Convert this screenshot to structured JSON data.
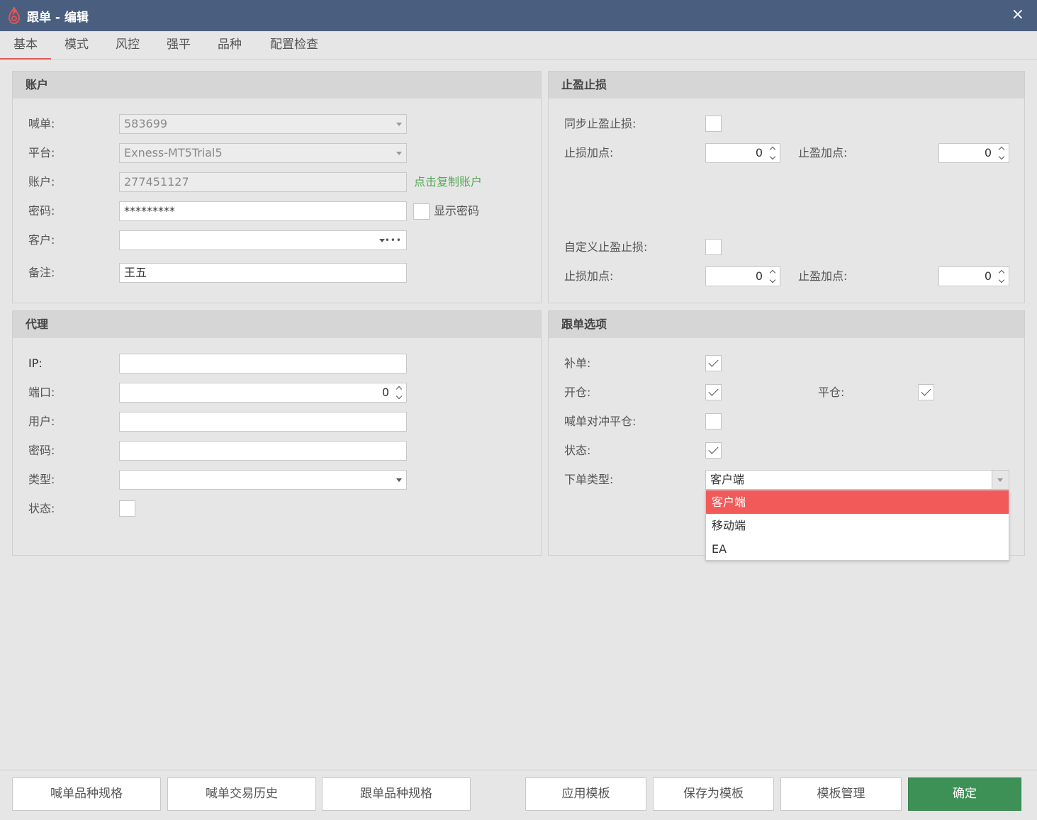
{
  "window": {
    "title": "跟单 - 编辑",
    "close_icon": "×",
    "logo_color": "#e25656",
    "titlebar_color": "#4a5e80"
  },
  "tabs": [
    {
      "label": "基本",
      "active": true
    },
    {
      "label": "模式"
    },
    {
      "label": "风控"
    },
    {
      "label": "强平"
    },
    {
      "label": "品种"
    },
    {
      "label": "配置检查"
    }
  ],
  "account": {
    "header": "账户",
    "caller_label": "喊单:",
    "caller_value": "583699",
    "platform_label": "平台:",
    "platform_value": "Exness-MT5Trial5",
    "account_label": "账户:",
    "account_value": "277451127",
    "copy_link": "点击复制账户",
    "password_label": "密码:",
    "password_value": "*********",
    "show_password": "显示密码",
    "client_label": "客户:",
    "client_value": "",
    "note_label": "备注:",
    "note_value": "王五"
  },
  "tpsl": {
    "header": "止盈止损",
    "sync_label": "同步止盈止损:",
    "sl_label": "止损加点:",
    "sl_value": "0",
    "tp_label": "止盈加点:",
    "tp_value": "0",
    "custom_label": "自定义止盈止损:",
    "sl2_label": "止损加点:",
    "sl2_value": "0",
    "tp2_label": "止盈加点:",
    "tp2_value": "0"
  },
  "proxy": {
    "header": "代理",
    "ip_label": "IP:",
    "ip_value": "",
    "port_label": "端口:",
    "port_value": "0",
    "user_label": "用户:",
    "user_value": "",
    "password_label": "密码:",
    "password_value": "",
    "type_label": "类型:",
    "type_value": "",
    "status_label": "状态:"
  },
  "options": {
    "header": "跟单选项",
    "supplement_label": "补单:",
    "supplement_checked": true,
    "open_label": "开仓:",
    "open_checked": true,
    "close_label": "平仓:",
    "close_checked": true,
    "hedge_label": "喊单对冲平仓:",
    "hedge_checked": false,
    "status_label": "状态:",
    "status_checked": true,
    "order_type_label": "下单类型:",
    "order_type_value": "客户端",
    "order_type_options": [
      "客户端",
      "移动端",
      "EA"
    ],
    "selected_color": "#f25a5a"
  },
  "footer": {
    "caller_spec": "喊单品种规格",
    "caller_history": "喊单交易历史",
    "follower_spec": "跟单品种规格",
    "apply_template": "应用模板",
    "save_template": "保存为模板",
    "manage_template": "模板管理",
    "confirm": "确定",
    "confirm_color": "#3d9156"
  }
}
